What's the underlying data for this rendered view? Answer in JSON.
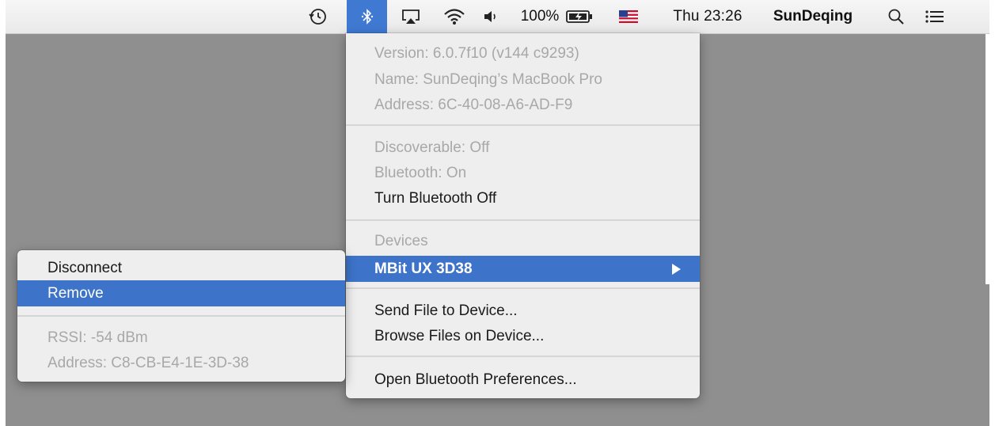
{
  "menubar": {
    "battery_percent": "100%",
    "clock": "Thu 23:26",
    "user": "SunDeqing",
    "icons": [
      "time-machine-icon",
      "bluetooth-icon",
      "airplay-icon",
      "wifi-icon",
      "volume-icon",
      "battery-icon",
      "flag-icon",
      "spotlight-icon",
      "notification-center-icon"
    ],
    "colors": {
      "active_bg": "#3f79d1"
    }
  },
  "bluetooth_menu": {
    "version": "Version: 6.0.7f10 (v144 c9293)",
    "name": "Name: SunDeqing’s MacBook Pro",
    "address": "Address: 6C-40-08-A6-AD-F9",
    "discoverable": "Discoverable: Off",
    "bluetooth_status": "Bluetooth: On",
    "turn_off": "Turn Bluetooth Off",
    "devices_header": "Devices",
    "device_name": "MBit UX 3D38",
    "send_file": "Send File to Device...",
    "browse_files": "Browse Files on Device...",
    "open_prefs": "Open Bluetooth Preferences...",
    "colors": {
      "highlight": "#3d74c9"
    }
  },
  "device_submenu": {
    "disconnect": "Disconnect",
    "remove": "Remove",
    "rssi": "RSSI: -54 dBm",
    "address": "Address: C8-CB-E4-1E-3D-38"
  }
}
